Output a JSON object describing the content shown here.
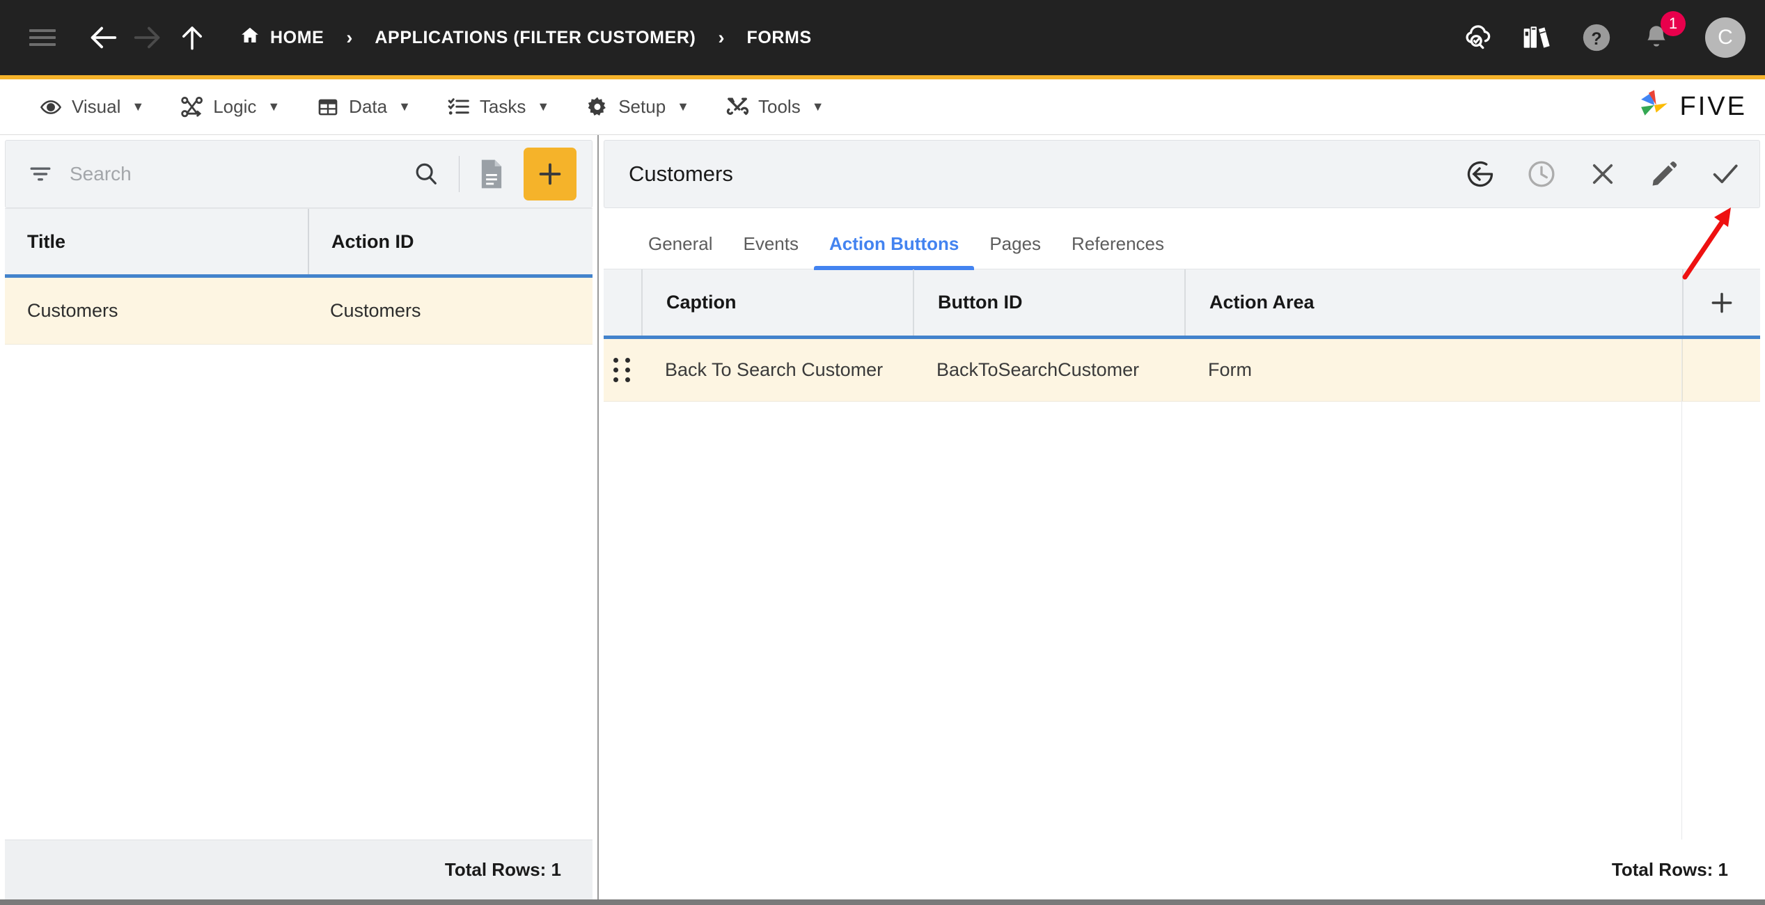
{
  "topbar": {
    "menu_icon": "hamburger-icon",
    "back_icon": "arrow-left-icon",
    "forward_icon": "arrow-right-icon",
    "up_icon": "arrow-up-icon",
    "breadcrumb": [
      {
        "label": "HOME",
        "icon": "home-icon"
      },
      {
        "label": "APPLICATIONS (FILTER CUSTOMER)",
        "icon": ""
      },
      {
        "label": "FORMS",
        "icon": ""
      }
    ],
    "separator": "›",
    "right_icons": [
      {
        "name": "cloud-check-search-icon"
      },
      {
        "name": "books-library-icon"
      },
      {
        "name": "help-question-icon"
      },
      {
        "name": "notification-bell-icon",
        "badge": "1"
      }
    ],
    "avatar_initial": "C",
    "badge_color": "#e8004c",
    "background": "#222222",
    "accent_color": "#f5b32a"
  },
  "menubar": {
    "items": [
      {
        "label": "Visual",
        "icon": "eye-icon",
        "caret": "▼"
      },
      {
        "label": "Logic",
        "icon": "logic-flow-icon",
        "caret": "▼"
      },
      {
        "label": "Data",
        "icon": "table-grid-icon",
        "caret": "▼"
      },
      {
        "label": "Tasks",
        "icon": "checklist-icon",
        "caret": "▼"
      },
      {
        "label": "Setup",
        "icon": "gear-icon",
        "caret": "▼"
      },
      {
        "label": "Tools",
        "icon": "tools-wrench-icon",
        "caret": "▼"
      }
    ],
    "logo_text": "FIVE"
  },
  "left_panel": {
    "search": {
      "placeholder": "Search",
      "value": "",
      "filter_icon": "filter-icon",
      "search_icon": "magnifier-icon",
      "doc_icon": "document-icon",
      "add_label": "+"
    },
    "table": {
      "columns": [
        "Title",
        "Action ID"
      ],
      "rows": [
        {
          "title": "Customers",
          "action_id": "Customers"
        }
      ],
      "footer": "Total Rows: 1"
    }
  },
  "right_panel": {
    "title": "Customers",
    "toolbar": [
      {
        "name": "back-circle-icon"
      },
      {
        "name": "history-clock-icon"
      },
      {
        "name": "close-x-icon"
      },
      {
        "name": "edit-pencil-icon"
      },
      {
        "name": "save-check-icon"
      }
    ],
    "tabs": [
      {
        "label": "General",
        "active": false
      },
      {
        "label": "Events",
        "active": false
      },
      {
        "label": "Action Buttons",
        "active": true
      },
      {
        "label": "Pages",
        "active": false
      },
      {
        "label": "References",
        "active": false
      }
    ],
    "table": {
      "columns": [
        "Caption",
        "Button ID",
        "Action Area"
      ],
      "add_column_label": "+",
      "rows": [
        {
          "drag": "drag-handle-icon",
          "caption": "Back To Search Customer",
          "button_id": "BackToSearchCustomer",
          "action_area": "Form"
        }
      ],
      "footer": "Total Rows: 1"
    }
  },
  "annotation": {
    "arrow": "red-arrow-pointing-to-save-check",
    "color": "#ee1111"
  }
}
